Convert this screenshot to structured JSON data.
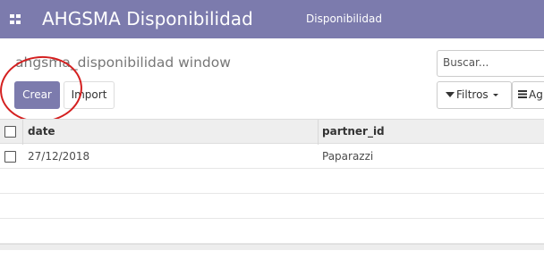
{
  "header": {
    "app_title": "AHGSMA Disponibilidad",
    "menu_item": "Disponibilidad"
  },
  "control_panel": {
    "breadcrumb": "ahgsma_disponibilidad window",
    "search_placeholder": "Buscar...",
    "create_label": "Crear",
    "import_label": "Import",
    "filters_label": "Filtros",
    "group_label": "Ag"
  },
  "table": {
    "columns": [
      "date",
      "partner_id"
    ],
    "rows": [
      {
        "date": "27/12/2018",
        "partner_id": "Paparazzi"
      }
    ]
  },
  "colors": {
    "brand": "#7c7bad",
    "annotation": "#d42020"
  }
}
